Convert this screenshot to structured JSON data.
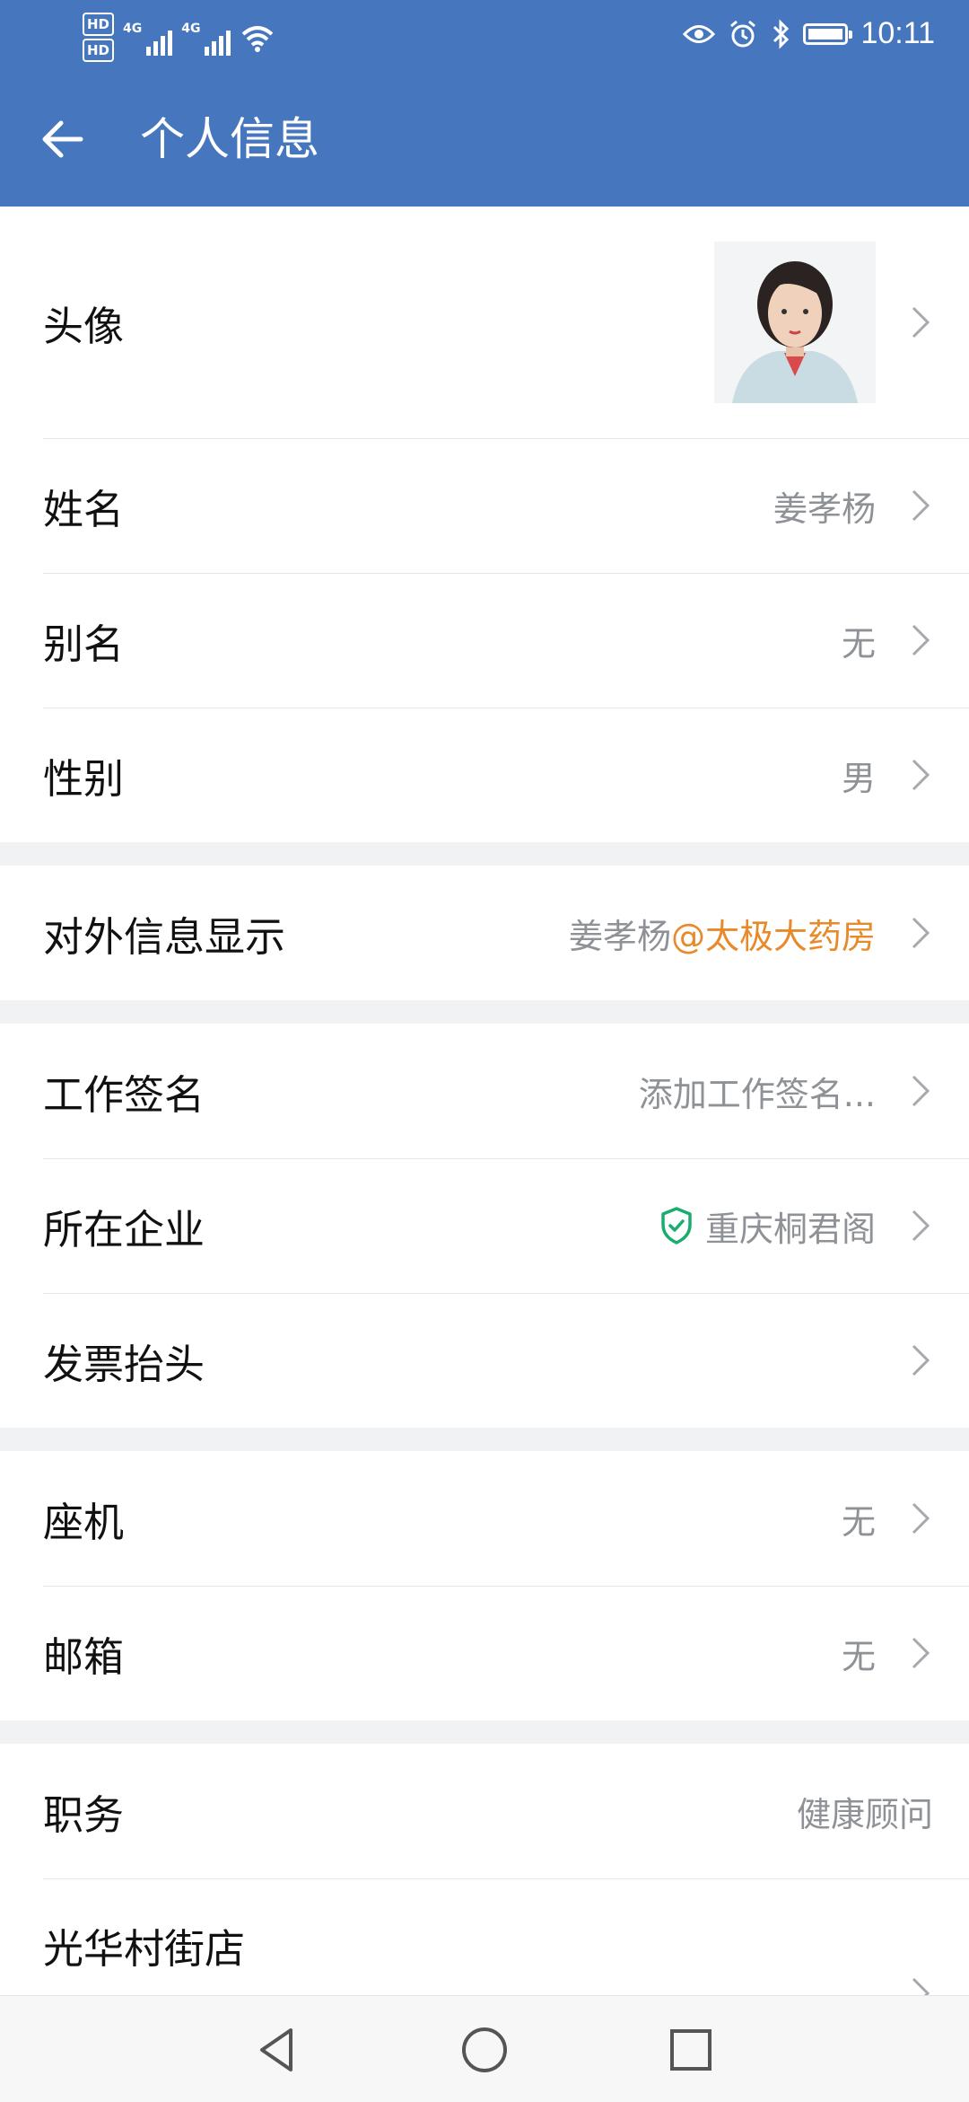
{
  "status_bar": {
    "hd1": "HD",
    "hd2": "HD",
    "net1": "4G",
    "net2": "4G",
    "time": "10:11"
  },
  "header": {
    "title": "个人信息"
  },
  "rows": {
    "avatar": {
      "label": "头像"
    },
    "name": {
      "label": "姓名",
      "value": "姜孝杨"
    },
    "alias": {
      "label": "别名",
      "value": "无"
    },
    "gender": {
      "label": "性别",
      "value": "男"
    },
    "external": {
      "label": "对外信息显示",
      "value_name": "姜孝杨",
      "value_org": "@太极大药房"
    },
    "signature": {
      "label": "工作签名",
      "value": "添加工作签名..."
    },
    "company": {
      "label": "所在企业",
      "value": "重庆桐君阁"
    },
    "invoice": {
      "label": "发票抬头"
    },
    "landline": {
      "label": "座机",
      "value": "无"
    },
    "email": {
      "label": "邮箱",
      "value": "无"
    },
    "position": {
      "label": "职务",
      "value": "健康顾问"
    },
    "store": {
      "label": "光华村街店"
    }
  },
  "colors": {
    "primary": "#4677be",
    "accent_orange": "#e8892a",
    "verified_green": "#1aad6f",
    "secondary_text": "#8e9196"
  },
  "icons": [
    "back-arrow-icon",
    "chevron-right-icon",
    "shield-check-icon",
    "eye-icon",
    "alarm-icon",
    "bluetooth-icon",
    "battery-icon",
    "wifi-icon",
    "nav-back-icon",
    "nav-home-icon",
    "nav-recents-icon"
  ]
}
